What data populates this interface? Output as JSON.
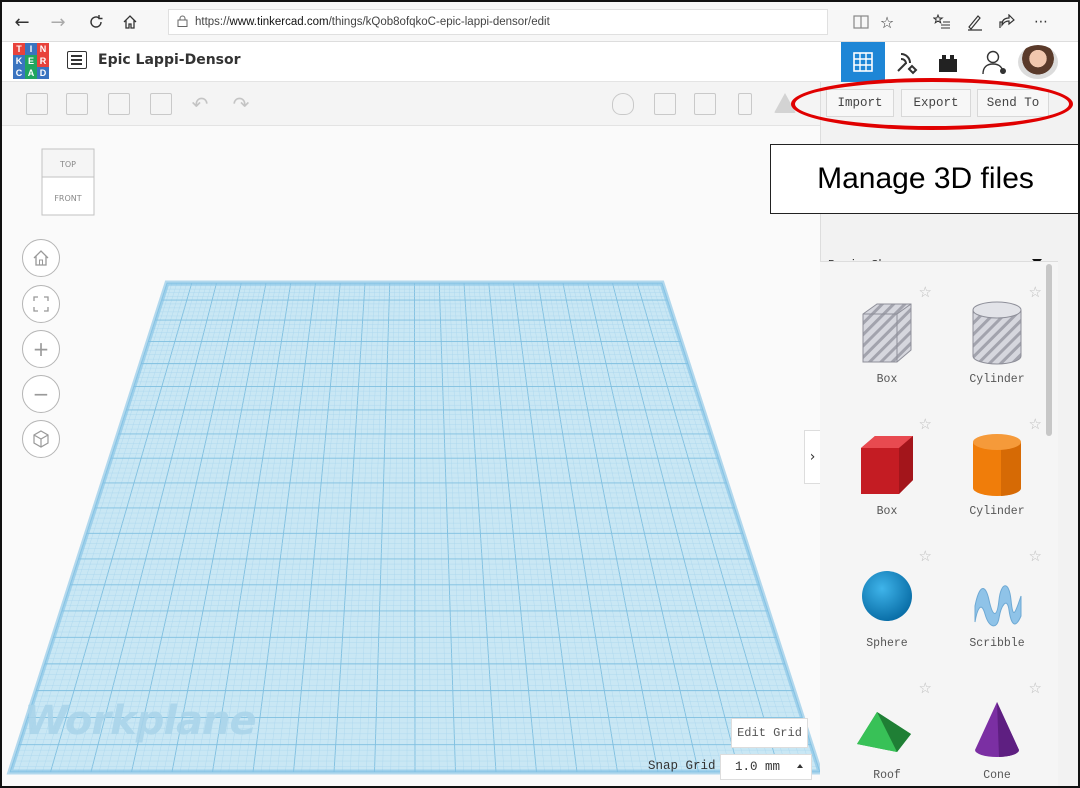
{
  "browser": {
    "url_prefix": "https://",
    "url_domain": "www.tinkercad.com",
    "url_path": "/things/kQob8ofqkoC-epic-lappi-densor/edit"
  },
  "app": {
    "logo_letters": [
      "T",
      "I",
      "N",
      "K",
      "E",
      "R",
      "C",
      "A",
      "D"
    ],
    "logo_colors": [
      "#e8423b",
      "#3a74c0",
      "#e8423b",
      "#3a74c0",
      "#21a55f",
      "#e8423b",
      "#3a74c0",
      "#21a55f",
      "#3a74c0"
    ],
    "doc_title": "Epic Lappi-Densor"
  },
  "panel": {
    "import_label": "Import",
    "export_label": "Export",
    "send_to_label": "Send To",
    "category": "Basic Shapes",
    "shapes": [
      {
        "label": "Box",
        "kind": "hole-box"
      },
      {
        "label": "Cylinder",
        "kind": "hole-cylinder"
      },
      {
        "label": "Box",
        "kind": "box",
        "color": "#d9222a"
      },
      {
        "label": "Cylinder",
        "kind": "cylinder",
        "color": "#f07d0a"
      },
      {
        "label": "Sphere",
        "kind": "sphere",
        "color": "#1493d3"
      },
      {
        "label": "Scribble",
        "kind": "scribble",
        "color": "#8fc3e8"
      },
      {
        "label": "Roof",
        "kind": "roof",
        "color": "#2ea44a"
      },
      {
        "label": "Cone",
        "kind": "cone",
        "color": "#7b2fa3"
      }
    ]
  },
  "viewport": {
    "viewcube_top": "TOP",
    "viewcube_front": "FRONT",
    "workplane_label": "Workplane",
    "edit_grid_label": "Edit Grid",
    "snap_grid_label": "Snap Grid",
    "snap_grid_value": "1.0 mm"
  },
  "annotation": {
    "callout_text": "Manage 3D files",
    "highlight_color": "#e00000"
  }
}
